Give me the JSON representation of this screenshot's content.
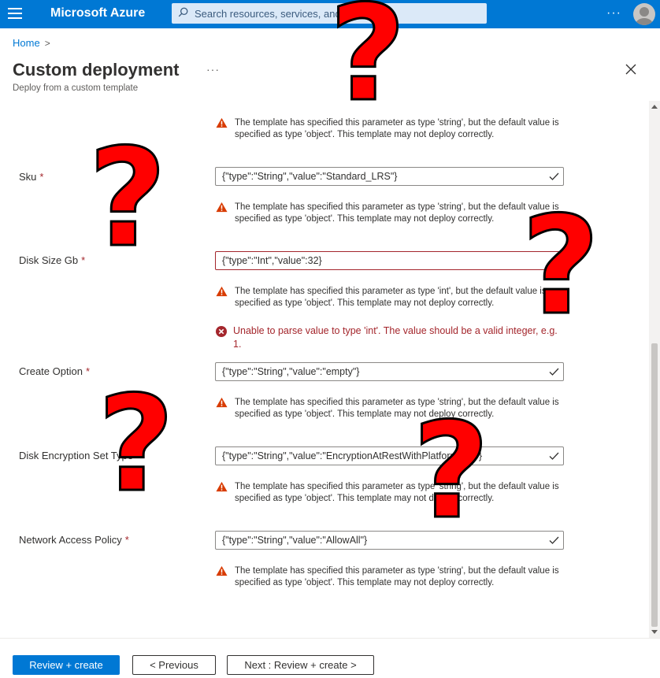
{
  "topbar": {
    "brand": "Microsoft Azure",
    "search_placeholder": "Search resources, services, and docs (G+/)",
    "more": "···"
  },
  "breadcrumb": {
    "home": "Home",
    "separator": ">"
  },
  "header": {
    "title": "Custom deployment",
    "subtitle": "Deploy from a custom template",
    "more": "···"
  },
  "messages": {
    "warn_string": "The template has specified this parameter as type 'string', but the default value is specified as type 'object'. This template may not deploy correctly.",
    "warn_int": "The template has specified this parameter as type 'int', but the default value is specified as type 'object'. This template may not deploy correctly.",
    "error_int": "Unable to parse value to type 'int'. The value should be a valid integer, e.g. 1."
  },
  "fields": {
    "sku": {
      "label": "Sku",
      "required": "*",
      "value": "{\"type\":\"String\",\"value\":\"Standard_LRS\"}"
    },
    "disk_size": {
      "label": "Disk Size Gb",
      "required": "*",
      "value": "{\"type\":\"Int\",\"value\":32}"
    },
    "create_option": {
      "label": "Create Option",
      "required": "*",
      "value": "{\"type\":\"String\",\"value\":\"empty\"}"
    },
    "disk_encryption": {
      "label": "Disk Encryption Set Type",
      "required": "*",
      "value": "{\"type\":\"String\",\"value\":\"EncryptionAtRestWithPlatformKey\"}"
    },
    "network_policy": {
      "label": "Network Access Policy",
      "required": "*",
      "value": "{\"type\":\"String\",\"value\":\"AllowAll\"}"
    }
  },
  "footer": {
    "review_create": "Review + create",
    "previous": "< Previous",
    "next": "Next : Review + create >"
  },
  "overlay": {
    "mark": "?"
  },
  "colors": {
    "azure_blue": "#0078d4",
    "warning": "#d83b01",
    "error": "#a4262c",
    "success_check": "#323130",
    "overlay_red": "#ff0000"
  }
}
